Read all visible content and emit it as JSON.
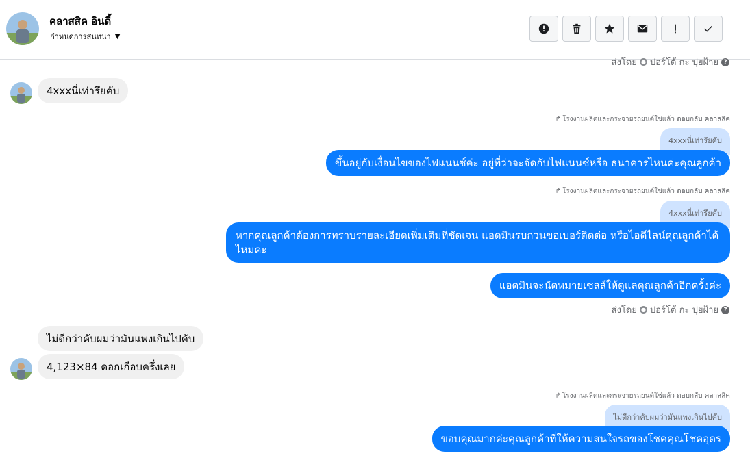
{
  "header": {
    "name": "คลาสสิค อินดี้",
    "subtitle": "กำหนดการสนทนา"
  },
  "actions": [
    {
      "icon": "alert-circle-icon",
      "label": "mark-spam"
    },
    {
      "icon": "trash-icon",
      "label": "delete"
    },
    {
      "icon": "star-icon",
      "label": "star"
    },
    {
      "icon": "envelope-icon",
      "label": "mark-unread"
    },
    {
      "icon": "exclamation-icon",
      "label": "important"
    },
    {
      "icon": "check-icon",
      "label": "done"
    }
  ],
  "status_top": {
    "sent_by": "ส่งโดย",
    "agent": "ปอร์โต้ กะ ปุยฝ้าย"
  },
  "messages": {
    "m1": "4xxxนี่เท่ารึยคับ",
    "reply1_label": "โรงงานผลิตและกระจายรถยนต์ใช่แล้ว ตอบกลับ คลาสสิค",
    "quote1": "4xxxนี่เท่ารึยคับ",
    "m2": "ขึ้นอยู่กับเงื่อนไขของไฟแนนซ์ค่ะ อยู่ที่ว่าจะจัดกับไฟแนนซ์หรือ ธนาคารไหนค่ะคุณลูกค้า",
    "reply2_label": "โรงงานผลิตและกระจายรถยนต์ใช่แล้ว ตอบกลับ คลาสสิค",
    "quote2": "4xxxนี่เท่ารึยคับ",
    "m3": "หากคุณลูกค้าต้องการทราบรายละเอียดเพิ่มเติมที่ชัดเจน แอดมินรบกวนขอเบอร์ติดต่อ หรือไอดีไลน์คุณลูกค้าได้ไหมคะ",
    "m4": "แอดมินจะนัดหมายเซลล์ให้ดูแลคุณลูกค้าอีกครั้งค่ะ",
    "m5": "ไม่ดีกว่าคับผมว่ามันแพงเกินไปคับ",
    "m6": "4,123×84 ดอกเกือบครึ่งเลย",
    "reply3_label": "โรงงานผลิตและกระจายรถยนต์ใช่แล้ว ตอบกลับ คลาสสิค",
    "quote3": "ไม่ดีกว่าคับผมว่ามันแพงเกินไปคับ",
    "m7": "ขอบคุณมากค่ะคุณลูกค้าที่ให้ความสนใจรถของโชคคุณโชคอุดร"
  },
  "status_mid": {
    "sent_by": "ส่งโดย",
    "agent": "ปอร์โต้ กะ ปุยฝ้าย"
  },
  "colors": {
    "outgoing": "#0a7cff",
    "incoming": "#f0f0f0",
    "quote": "#cfe3ff"
  }
}
